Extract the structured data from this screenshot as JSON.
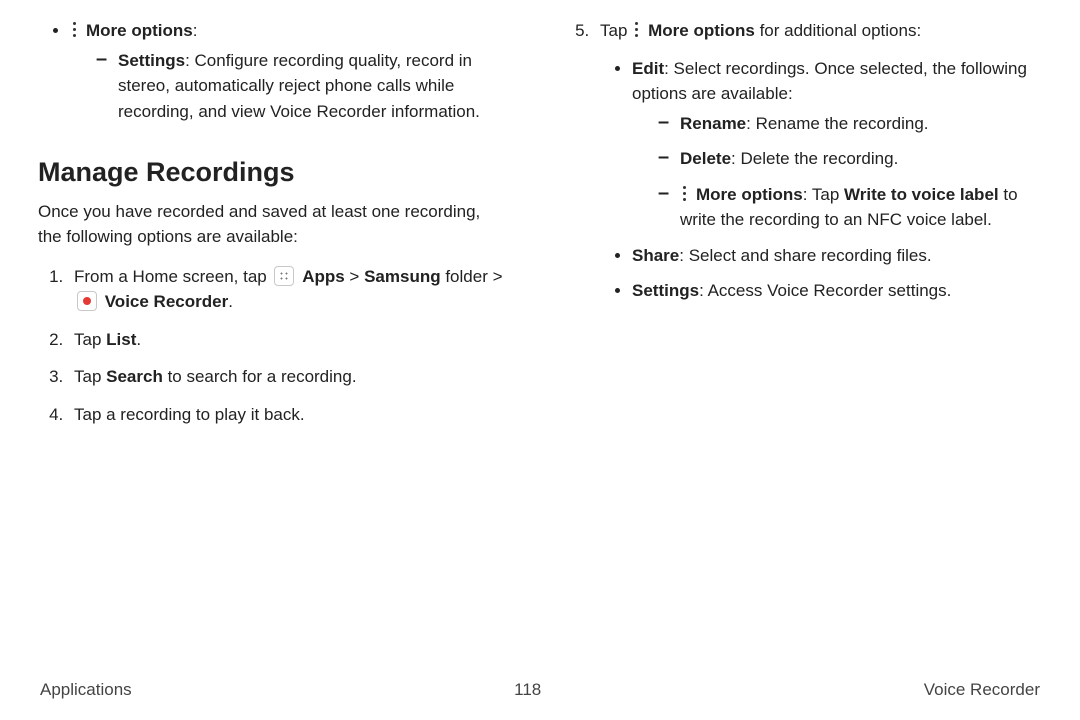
{
  "left": {
    "more_options_label": "More options",
    "settings_label": "Settings",
    "settings_desc": ": Configure recording quality, record in stereo, automatically reject phone calls while recording, and view Voice Recorder information.",
    "heading": "Manage Recordings",
    "intro": "Once you have recorded and saved at least one recording, the following options are available:",
    "step1_a": "From a Home screen, tap ",
    "step1_apps": "Apps",
    "step1_b": " > ",
    "step1_samsung": "Samsung",
    "step1_c": " folder > ",
    "step1_vr": "Voice Recorder",
    "step1_d": ".",
    "step2_a": "Tap ",
    "step2_list": "List",
    "step2_b": ".",
    "step3_a": "Tap ",
    "step3_search": "Search",
    "step3_b": " to search for a recording.",
    "step4": "Tap a recording to play it back."
  },
  "right": {
    "step5_a": "Tap ",
    "step5_more": "More options",
    "step5_b": " for additional options:",
    "edit_label": "Edit",
    "edit_desc": ": Select recordings. Once selected, the following options are available:",
    "rename_label": "Rename",
    "rename_desc": ": Rename the recording.",
    "delete_label": "Delete",
    "delete_desc": ": Delete the recording.",
    "mo_label": "More options",
    "mo_a": ": Tap ",
    "mo_write": "Write to voice label",
    "mo_b": " to write the recording to an NFC voice label.",
    "share_label": "Share",
    "share_desc": ": Select and share recording files.",
    "settings_label": "Settings",
    "settings_desc": ": Access Voice Recorder settings."
  },
  "footer": {
    "left": "Applications",
    "center": "118",
    "right": "Voice Recorder"
  }
}
